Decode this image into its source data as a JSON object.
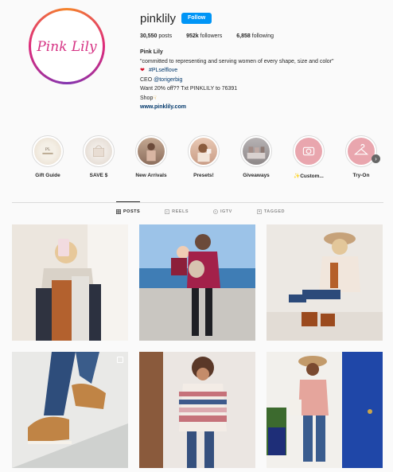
{
  "profile": {
    "username": "pinklily",
    "follow_label": "Follow",
    "logo_text": "Pink Lily"
  },
  "stats": {
    "posts_value": "30,550",
    "posts_label": "posts",
    "followers_value": "952k",
    "followers_label": "followers",
    "following_value": "6,858",
    "following_label": "following"
  },
  "bio": {
    "name": "Pink Lily",
    "line1": "\"committed to representing and serving women of every shape, size and color\"",
    "hashtag": "#PLselflove",
    "ceo_prefix": "CEO",
    "ceo_handle": "@torigerbig",
    "offer": "Want 20% off?? Txt PINKLILY to 76391",
    "shop": "Shop",
    "website": "www.pinklily.com"
  },
  "highlights": [
    {
      "label": "Gift Guide"
    },
    {
      "label": "SAVE $"
    },
    {
      "label": "New Arrivals"
    },
    {
      "label": "Presets!"
    },
    {
      "label": "Giveaways"
    },
    {
      "label": "Custom..."
    },
    {
      "label": "Try-On"
    }
  ],
  "tabs": [
    {
      "label": "POSTS"
    },
    {
      "label": "REELS"
    },
    {
      "label": "IGTV"
    },
    {
      "label": "TAGGED"
    }
  ],
  "colors": {
    "accent": "#0095f6",
    "text": "#262626",
    "link": "#00376b",
    "brand_pink": "#d63384"
  }
}
